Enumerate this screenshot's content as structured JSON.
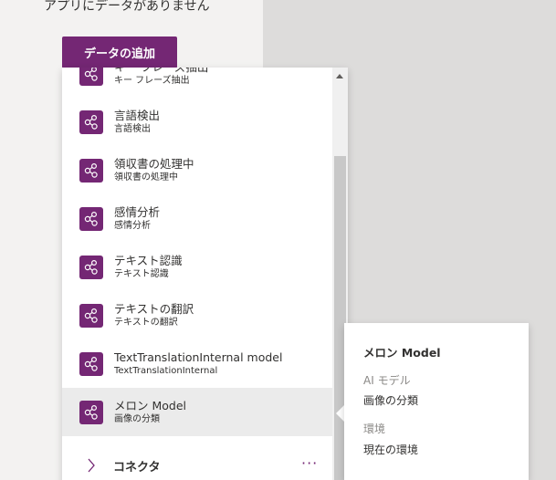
{
  "left_panel": {
    "no_data_text": "アプリにデータがありません",
    "add_data_label": "データの追加"
  },
  "dropdown": {
    "items": [
      {
        "title": "キー フレーズ抽出",
        "subtitle": "キー フレーズ抽出",
        "icon": "ai-model-icon"
      },
      {
        "title": "言語検出",
        "subtitle": "言語検出",
        "icon": "ai-model-icon"
      },
      {
        "title": "領収書の処理中",
        "subtitle": "領収書の処理中",
        "icon": "ai-model-icon"
      },
      {
        "title": "感情分析",
        "subtitle": "感情分析",
        "icon": "ai-model-icon"
      },
      {
        "title": "テキスト認識",
        "subtitle": "テキスト認識",
        "icon": "ai-model-icon"
      },
      {
        "title": "テキストの翻訳",
        "subtitle": "テキストの翻訳",
        "icon": "ai-model-icon"
      },
      {
        "title": "TextTranslationInternal model",
        "subtitle": "TextTranslationInternal",
        "icon": "ai-model-icon"
      },
      {
        "title": "メロン Model",
        "subtitle": "画像の分類",
        "icon": "ai-model-icon",
        "selected": true
      }
    ],
    "connector_label": "コネクタ",
    "more_label": "···"
  },
  "callout": {
    "title": "メロン Model",
    "type_label": "AI モデル",
    "type_value": "画像の分類",
    "env_label": "環境",
    "env_value": "現在の環境"
  },
  "colors": {
    "accent": "#742774",
    "selected_bg": "#ebebeb",
    "panel_bg": "#f3f2f1",
    "canvas_bg": "#dddcdb"
  }
}
